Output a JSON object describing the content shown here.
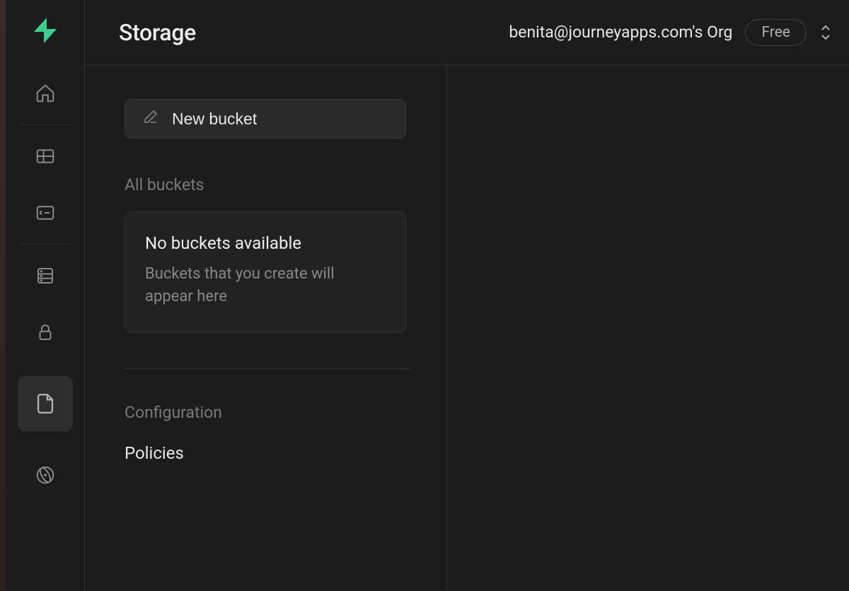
{
  "header": {
    "title": "Storage",
    "org": "benita@journeyapps.com's Org",
    "plan": "Free"
  },
  "side": {
    "new_bucket_label": "New bucket",
    "all_buckets_label": "All buckets",
    "empty_title": "No buckets available",
    "empty_sub": "Buckets that you create will appear here",
    "config_label": "Configuration",
    "policies_label": "Policies"
  },
  "rail": {
    "items": [
      "home",
      "table-editor",
      "sql-editor",
      "database",
      "auth",
      "storage",
      "edge-functions"
    ]
  }
}
